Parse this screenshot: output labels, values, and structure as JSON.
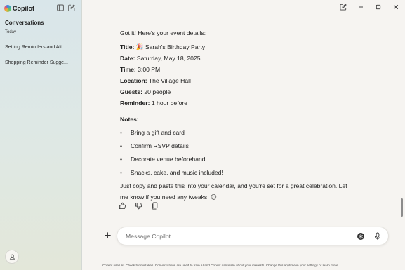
{
  "app": {
    "name": "Copilot"
  },
  "sidebar": {
    "section_title": "Conversations",
    "section_subtitle": "Today",
    "items": [
      {
        "label": "Setting Reminders and Alt..."
      },
      {
        "label": "Shopping Reminder Sugge..."
      }
    ]
  },
  "chat": {
    "intro": "Got it! Here's your event details:",
    "fields": [
      {
        "key": "Title:",
        "value": "🎉 Sarah's Birthday Party"
      },
      {
        "key": "Date:",
        "value": "Saturday, May 18, 2025"
      },
      {
        "key": "Time:",
        "value": "3:00 PM"
      },
      {
        "key": "Location:",
        "value": "The Village Hall"
      },
      {
        "key": "Guests:",
        "value": "20 people"
      },
      {
        "key": "Reminder:",
        "value": "1 hour before"
      }
    ],
    "notes_title": "Notes:",
    "notes": [
      "Bring a gift and card",
      "Confirm RSVP details",
      "Decorate venue beforehand",
      "Snacks, cake, and music included!"
    ],
    "closing_line1": "Just copy and paste this into your calendar, and you're set for a great celebration. Let",
    "closing_line2": "me know if you need any tweaks! 😊"
  },
  "composer": {
    "placeholder": "Message Copilot",
    "value": ""
  },
  "footer": {
    "text": "Copilot uses AI. Check for mistakes. Conversations are used to train AI and Copilot can learn about your interests. Change this anytime in your ",
    "settings_link": "settings",
    "or": " or ",
    "learn_link": "learn more",
    "end": "."
  },
  "colors": {
    "accent": "#2a8cf0",
    "sidebar_bg": "#dce7e6"
  },
  "icons": {
    "sidebar_toggle": "sidebar-toggle-icon",
    "new_chat": "new-chat-icon",
    "like": "thumbs-up-icon",
    "dislike": "thumbs-down-icon",
    "copy": "copy-icon"
  }
}
